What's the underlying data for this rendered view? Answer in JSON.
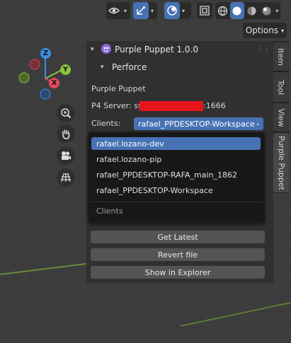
{
  "header": {
    "options_label": "Options",
    "icons": [
      "eye-icon",
      "transform-gizmo-icon",
      "overlay-icon",
      "xray-icon",
      "shading-wire-icon",
      "shading-solid-icon",
      "shading-material-icon",
      "shading-rendered-icon"
    ]
  },
  "gizmo": {
    "axes": [
      "Z",
      "Y",
      "X"
    ]
  },
  "panel": {
    "addon_title": "Purple Puppet 1.0.0",
    "subpanel_title": "Perforce",
    "section_label": "Purple Puppet",
    "p4_server_prefix": "P4 Server: ssl",
    "p4_server_port": ":1666",
    "clients_label": "Clients:",
    "clients_value": "rafael_PPDESKTOP-Workspace",
    "dropdown": {
      "items": [
        "rafael.lozano-dev",
        "rafael.lozano-pip",
        "rafael_PPDESKTOP-RAFA_main_1862",
        "rafael_PPDESKTOP-Workspace"
      ],
      "selected_index": 0,
      "footer": "Clients"
    },
    "buttons": [
      "Get Latest",
      "Revert file",
      "Show in Explorer"
    ]
  },
  "side_tabs": [
    "Item",
    "Tool",
    "View",
    "Purple Puppet"
  ],
  "colors": {
    "accent": "#4772b3",
    "redaction": "#e8141c",
    "axis_x": "#e34b5b",
    "axis_y": "#8cc43c",
    "axis_z": "#3d8fe0",
    "addon_icon": "#8a6ad6"
  }
}
